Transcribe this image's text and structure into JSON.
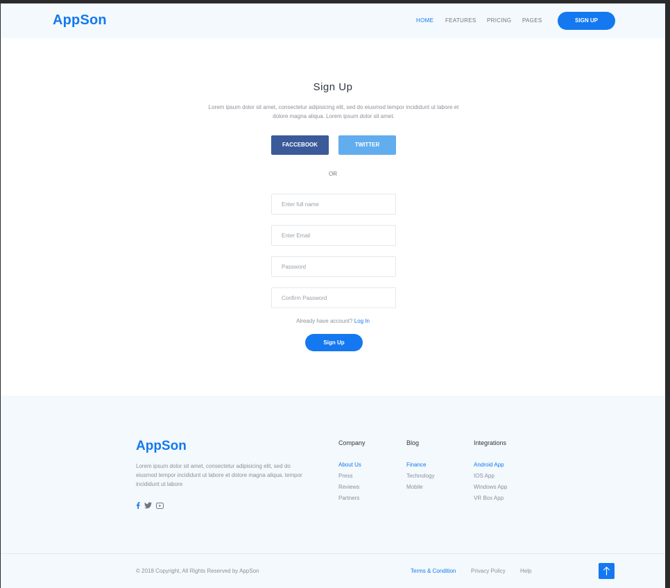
{
  "header": {
    "logo": "AppSon",
    "nav": [
      "HOME",
      "FEATURES",
      "PRICING",
      "PAGES"
    ],
    "signup_button": "SIGN UP"
  },
  "main": {
    "title": "Sign Up",
    "description": "Lorem ipsum dolor sit amet, consectetur adipisicing elit, sed do eiusmod tempor incididunt ut labore et dolore magna aliqua. Lorem ipsum dolor sit amet.",
    "facebook_button": "FACCEBOOK",
    "twitter_button": "TWITTER",
    "or_text": "OR",
    "fields": {
      "full_name_placeholder": "Enter full name",
      "email_placeholder": "Enter Email",
      "password_placeholder": "Password",
      "confirm_password_placeholder": "Confirm Password"
    },
    "have_account_text": "Already have account?",
    "login_link": "Log In",
    "signup_button": "Sign Up"
  },
  "footer": {
    "logo": "AppSon",
    "description": "Lorem ipsum dolor sit amet, consectetur adipisicing elit, sed do eiusmod tempor incididunt ut labore et dolore magna aliqua. tempor incididunt ut labore",
    "social_icons": [
      "facebook-icon",
      "twitter-icon",
      "youtube-icon"
    ],
    "columns": [
      {
        "heading": "Company",
        "items": [
          "About Us",
          "Press",
          "Reviews",
          "Partners"
        ]
      },
      {
        "heading": "Blog",
        "items": [
          "Finance",
          "Technology",
          "Mobile"
        ]
      },
      {
        "heading": "Integrations",
        "items": [
          "Android App",
          "IOS App",
          "Windows App",
          "VR Box App"
        ]
      }
    ],
    "copyright": "© 2018 Copyright, All Rights Reserved by AppSon",
    "bottom_links": [
      "Terms & Condition",
      "Privacy Policy",
      "Help"
    ],
    "accent_color": "#1478f0"
  }
}
